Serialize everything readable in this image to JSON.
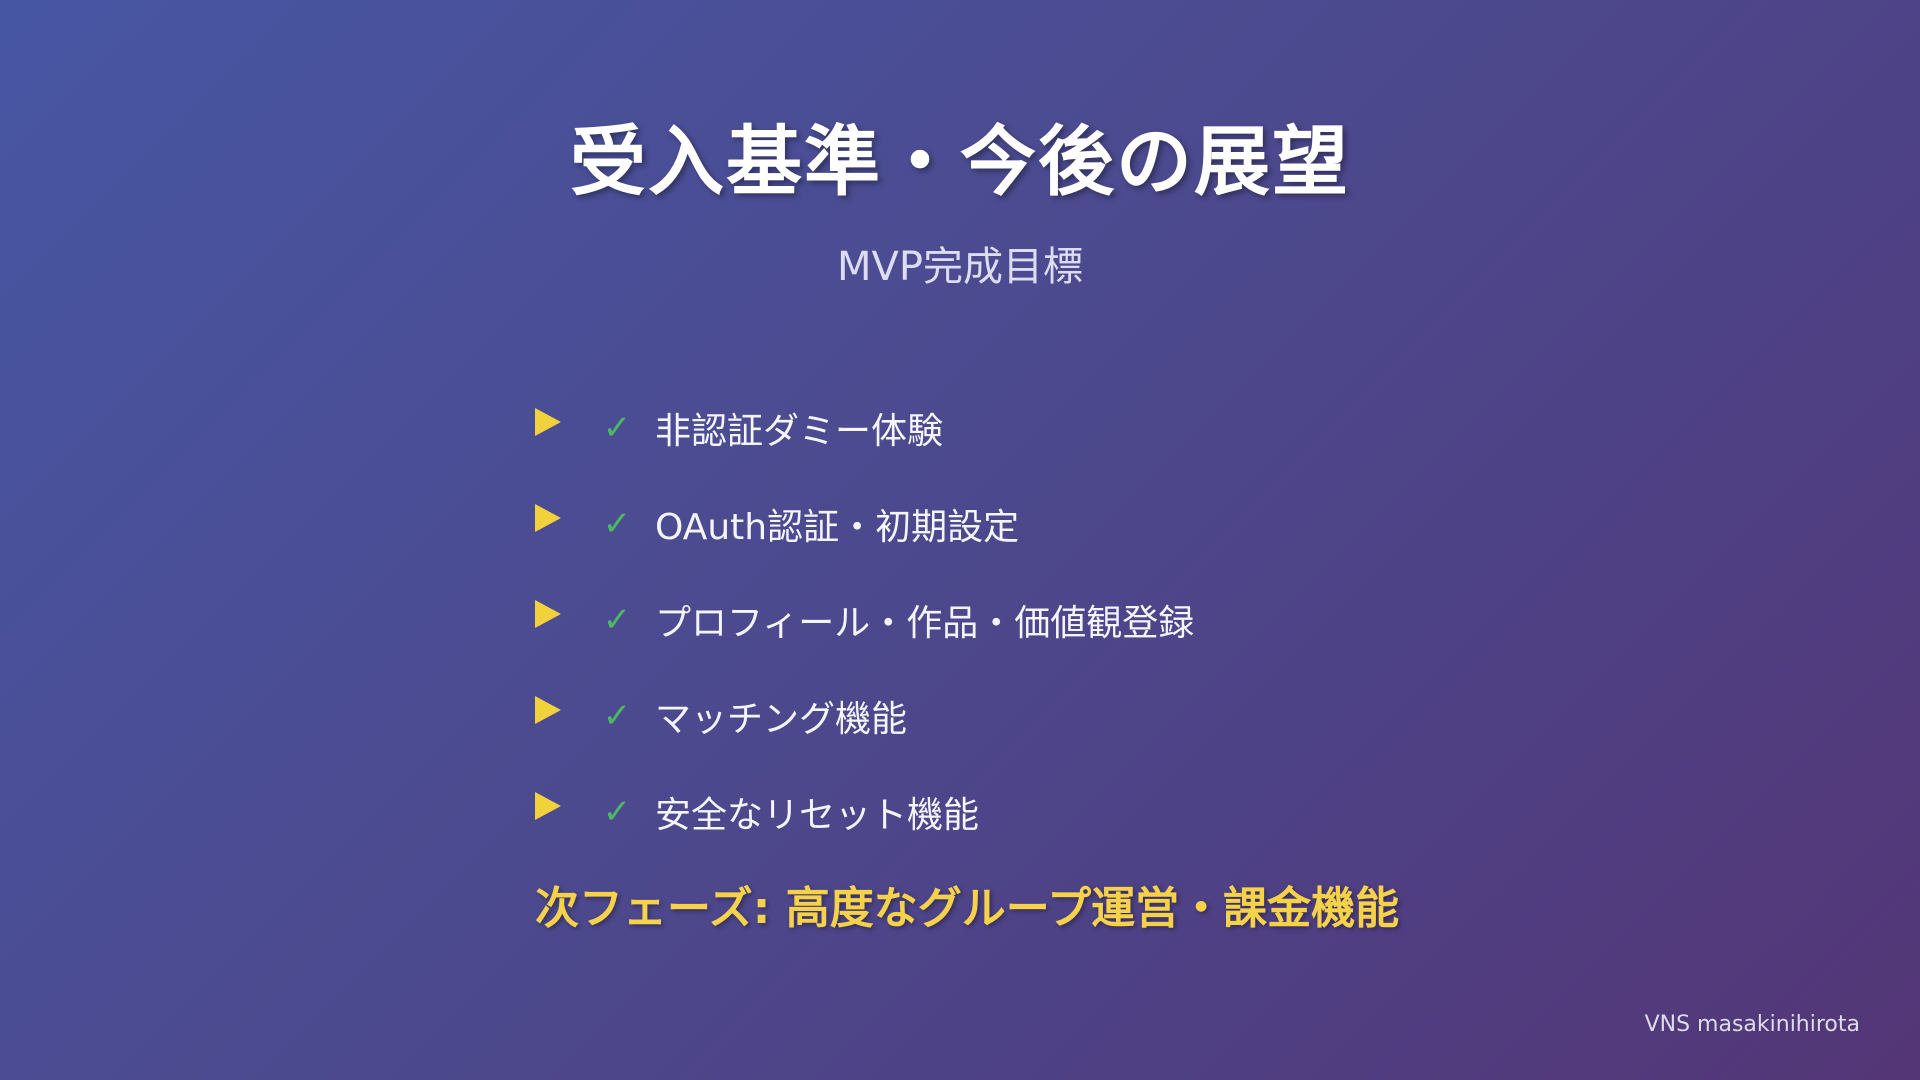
{
  "slide": {
    "title": "受入基準・今後の展望",
    "subtitle": "MVP完成目標",
    "items": [
      {
        "bullet_icon": "play-triangle-icon",
        "check_icon": "check-icon",
        "check": "✓",
        "label": "非認証ダミー体験"
      },
      {
        "bullet_icon": "play-triangle-icon",
        "check_icon": "check-icon",
        "check": "✓",
        "label": "OAuth認証・初期設定"
      },
      {
        "bullet_icon": "play-triangle-icon",
        "check_icon": "check-icon",
        "check": "✓",
        "label": "プロフィール・作品・価値観登録"
      },
      {
        "bullet_icon": "play-triangle-icon",
        "check_icon": "check-icon",
        "check": "✓",
        "label": "マッチング機能"
      },
      {
        "bullet_icon": "play-triangle-icon",
        "check_icon": "check-icon",
        "check": "✓",
        "label": "安全なリセット機能"
      }
    ],
    "next_phase": "次フェーズ: 高度なグループ運営・課金機能",
    "credit": "VNS masakinihirota"
  },
  "colors": {
    "background_start": "#4756a3",
    "background_end": "#543676",
    "title": "#ffffff",
    "bullet": "#f2d23c",
    "check": "#4cb862",
    "next_phase": "#f5d24a"
  }
}
